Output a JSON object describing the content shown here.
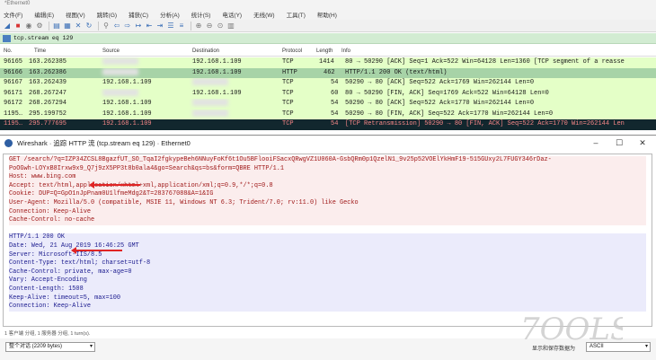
{
  "window": {
    "title": "*Ethernet0"
  },
  "menu": [
    "文件(F)",
    "编辑(E)",
    "视图(V)",
    "跳转(G)",
    "捕获(C)",
    "分析(A)",
    "统计(S)",
    "电话(Y)",
    "无线(W)",
    "工具(T)",
    "帮助(H)"
  ],
  "filter": {
    "value": "tcp.stream eq 129"
  },
  "packet_list": {
    "columns": {
      "no": "No.",
      "time": "Time",
      "source": "Source",
      "destination": "Destination",
      "protocol": "Protocol",
      "length": "Length",
      "info": "Info"
    },
    "rows": [
      {
        "no": "96165",
        "time": "163.262385",
        "source": "",
        "destination": "192.168.1.109",
        "protocol": "TCP",
        "length": "1414",
        "info": "80 → 50290 [ACK] Seq=1 Ack=522 Win=64128 Len=1360 [TCP segment of a reasse",
        "style": "green"
      },
      {
        "no": "96166",
        "time": "163.262386",
        "source": "",
        "destination": "192.168.1.109",
        "protocol": "HTTP",
        "length": "462",
        "info": "HTTP/1.1 200 OK  (text/html)",
        "style": "sel"
      },
      {
        "no": "96167",
        "time": "163.262439",
        "source": "192.168.1.109",
        "destination": "",
        "protocol": "TCP",
        "length": "54",
        "info": "50290 → 80 [ACK] Seq=522 Ack=1769 Win=262144 Len=0",
        "style": "green"
      },
      {
        "no": "96171",
        "time": "268.267247",
        "source": "",
        "destination": "192.168.1.109",
        "protocol": "TCP",
        "length": "60",
        "info": "80 → 50290 [FIN, ACK] Seq=1769 Ack=522 Win=64128 Len=0",
        "style": "green"
      },
      {
        "no": "96172",
        "time": "268.267294",
        "source": "192.168.1.109",
        "destination": "",
        "protocol": "TCP",
        "length": "54",
        "info": "50290 → 80 [ACK] Seq=522 Ack=1770 Win=262144 Len=0",
        "style": "green"
      },
      {
        "no": "1195…",
        "time": "295.199752",
        "source": "192.168.1.109",
        "destination": "",
        "protocol": "TCP",
        "length": "54",
        "info": "50290 → 80 [FIN, ACK] Seq=522 Ack=1770 Win=262144 Len=0",
        "style": "green"
      },
      {
        "no": "1195…",
        "time": "295.777695",
        "source": "192.168.1.109",
        "destination": "",
        "protocol": "TCP",
        "length": "54",
        "info": "[TCP Retransmission] 50290 → 80 [FIN, ACK] Seq=522 Ack=1770 Win=262144 Len",
        "style": "black"
      }
    ]
  },
  "dialog": {
    "title": "Wireshark · 追踪 HTTP 流 (tcp.stream eq 129) · Ethernet0",
    "request_lines": [
      "GET /search/?q=IZP34ZCSL8BgazfUT_SO_TqaI2fgkypeBeh6NNuyFoKf6t1Ou5BFlooiFSacxQRwgVZ1U060A-GsbQRm0p1QzelN1_9v25p52VOElYkHmF19-515GUxy2L7FUGY346rDaz-",
      "PoOGwh-LOYxB8Irxw9x9_Q7j9zX5PP3t8b0ala4&go=Search&qs=bs&form=QBRE HTTP/1.1",
      "Host: www.bing.com",
      "Accept: text/html,application/xhtml+xml,application/xml;q=0.9,*/*;q=0.8",
      "Cookie: DUP=Q=GpO1nJpPnam0U1lfmeMdg2&T=283767088&A=1&IG",
      "User-Agent: Mozilla/5.0 (compatible, MSIE 11, Windows NT 6.3; Trident/7.0; rv:11.0) like Gecko",
      "Connection: Keep-Alive",
      "Cache-Control: no-cache"
    ],
    "response_lines": [
      "HTTP/1.1 200 OK",
      "Date: Wed, 21 Aug 2019 16:46:25 GMT",
      "Server: Microsoft-IIS/8.5",
      "Content-Type: text/html; charset=utf-8",
      "Cache-Control: private, max-age=0",
      "Vary: Accept-Encoding",
      "Content-Length: 1508",
      "Keep-Alive: timeout=5, max=100",
      "Connection: Keep-Alive"
    ],
    "status_text": "1 客户端 分组, 1 服务器 分组, 1 turn(s).",
    "conversation_select": "整个对话 (2209 bytes)",
    "show_as_label": "显示和保存数据为",
    "show_as_value": "ASCII"
  },
  "watermark_text": "7OOLS",
  "colors": {
    "request_fg": "#a01a1a",
    "response_fg": "#1a1a8e",
    "filter_bg": "#d2ecd2",
    "selected_row": "#a7d3a7",
    "arrow": "#e02424"
  },
  "icons": [
    "file-open-icon",
    "save-icon",
    "close-icon",
    "reload-icon",
    "find-icon",
    "go-back-icon",
    "go-forward-icon",
    "go-to-icon",
    "first-packet-icon",
    "last-packet-icon",
    "colorize-icon",
    "zoom-in-icon",
    "zoom-out-icon",
    "normal-size-icon",
    "resize-columns-icon"
  ]
}
